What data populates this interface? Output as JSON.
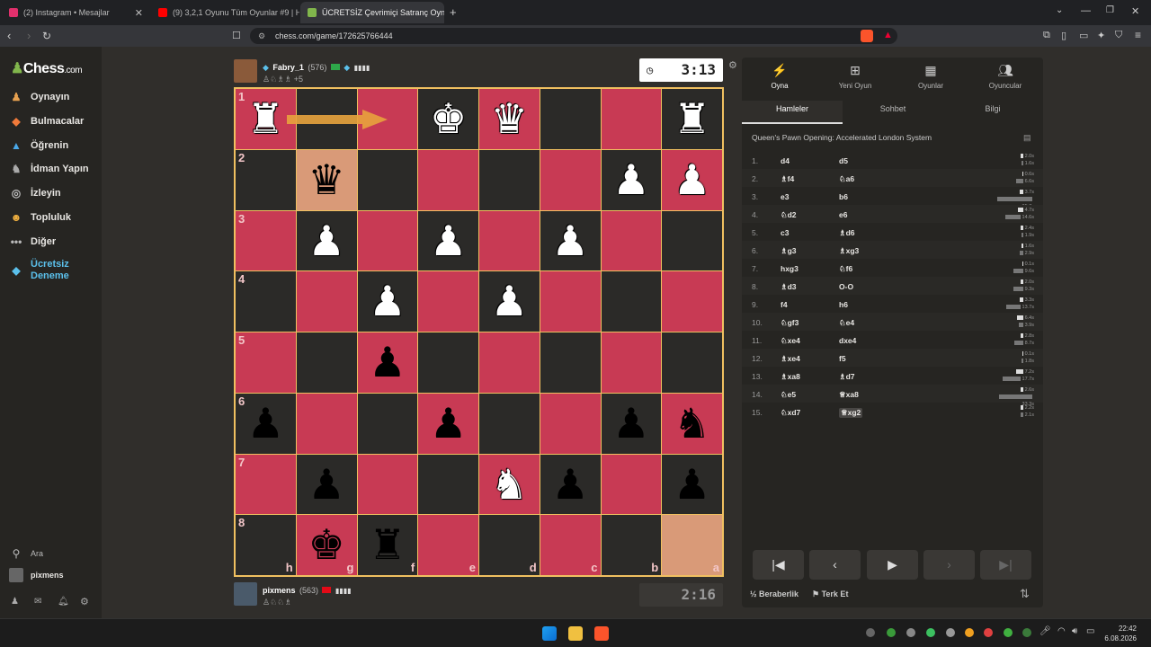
{
  "browser": {
    "tabs": [
      {
        "title": "(2) Instagram • Mesajlar",
        "color": "#e1306c"
      },
      {
        "title": "(9) 3,2,1 Oyunu Tüm Oyunlar #9 | Ht",
        "color": "#ff0000"
      },
      {
        "title": "ÜCRETSİZ Çevrimiçi Satranç Oyna",
        "color": "#81b64c"
      }
    ],
    "url": "chess.com/game/172625766444"
  },
  "sidebar": {
    "logo": "Chess",
    "logo_suffix": ".com",
    "items": [
      {
        "label": "Oynayın",
        "icon": "play-icon"
      },
      {
        "label": "Bulmacalar",
        "icon": "puzzle-icon"
      },
      {
        "label": "Öğrenin",
        "icon": "learn-icon"
      },
      {
        "label": "İdman Yapın",
        "icon": "train-icon"
      },
      {
        "label": "İzleyin",
        "icon": "watch-icon"
      },
      {
        "label": "Topluluk",
        "icon": "community-icon"
      },
      {
        "label": "Diğer",
        "icon": "more-icon"
      }
    ],
    "trial": "Ücretsiz Deneme",
    "search": "Ara",
    "user": "pixmens"
  },
  "players": {
    "top": {
      "name": "Fabry_1",
      "rating": "(576)",
      "captured": "♙♘♗♗ +5",
      "clock": "3:13"
    },
    "bottom": {
      "name": "pixmens",
      "rating": "(563)",
      "captured": "♙♘♘♗",
      "clock": "2:16"
    }
  },
  "board": {
    "ranks": [
      "1",
      "2",
      "3",
      "4",
      "5",
      "6",
      "7",
      "8"
    ],
    "files": [
      "h",
      "g",
      "f",
      "e",
      "d",
      "c",
      "b",
      "a"
    ],
    "rows": [
      [
        "wR",
        "",
        "",
        "wK",
        "wQ",
        "",
        "",
        "wR"
      ],
      [
        "",
        "bQ",
        "",
        "",
        "",
        "",
        "wP",
        "wP"
      ],
      [
        "",
        "wP",
        "",
        "wP",
        "",
        "wP",
        "",
        ""
      ],
      [
        "",
        "",
        "wP",
        "",
        "wP",
        "",
        "",
        ""
      ],
      [
        "",
        "",
        "bP",
        "",
        "",
        "",
        "",
        ""
      ],
      [
        "bP",
        "",
        "",
        "bP",
        "",
        "",
        "bP",
        "bN"
      ],
      [
        "",
        "bP",
        "",
        "",
        "wN",
        "bP",
        "",
        "bP"
      ],
      [
        "",
        "bK",
        "bR",
        "",
        "",
        "",
        "",
        ""
      ]
    ],
    "highlights": [
      [
        1,
        1
      ],
      [
        7,
        7
      ]
    ]
  },
  "panel": {
    "tabs": [
      {
        "label": "Oyna",
        "icon": "play-icon"
      },
      {
        "label": "Yeni Oyun",
        "icon": "plus-icon"
      },
      {
        "label": "Oyunlar",
        "icon": "board-icon"
      },
      {
        "label": "Oyuncular",
        "icon": "players-icon"
      }
    ],
    "subtabs": [
      "Hamleler",
      "Sohbet",
      "Bilgi"
    ],
    "opening": "Queen's Pawn Opening: Accelerated London System",
    "moves": [
      {
        "n": "1.",
        "w": "d4",
        "b": "d5",
        "tw": "2.0s",
        "tb": "1.6s"
      },
      {
        "n": "2.",
        "w": "♗f4",
        "b": "♘a6",
        "tw": "0.6s",
        "tb": "6.6s"
      },
      {
        "n": "3.",
        "w": "e3",
        "b": "b6",
        "tw": "3.7s",
        "tb": "35.7s"
      },
      {
        "n": "4.",
        "w": "♘d2",
        "b": "e6",
        "tw": "4.7s",
        "tb": "14.6s"
      },
      {
        "n": "5.",
        "w": "c3",
        "b": "♗d6",
        "tw": "2.4s",
        "tb": "1.9s"
      },
      {
        "n": "6.",
        "w": "♗g3",
        "b": "♗xg3",
        "tw": "1.6s",
        "tb": "2.9s"
      },
      {
        "n": "7.",
        "w": "hxg3",
        "b": "♘f6",
        "tw": "0.1s",
        "tb": "9.6s"
      },
      {
        "n": "8.",
        "w": "♗d3",
        "b": "O-O",
        "tw": "2.0s",
        "tb": "9.3s"
      },
      {
        "n": "9.",
        "w": "f4",
        "b": "h6",
        "tw": "3.3s",
        "tb": "13.7s"
      },
      {
        "n": "10.",
        "w": "♘gf3",
        "b": "♘e4",
        "tw": "6.4s",
        "tb": "3.9s"
      },
      {
        "n": "11.",
        "w": "♘xe4",
        "b": "dxe4",
        "tw": "2.8s",
        "tb": "8.7s"
      },
      {
        "n": "12.",
        "w": "♗xe4",
        "b": "f5",
        "tw": "0.1s",
        "tb": "1.8s"
      },
      {
        "n": "13.",
        "w": "♗xa8",
        "b": "♗d7",
        "tw": "7.2s",
        "tb": "17.7s"
      },
      {
        "n": "14.",
        "w": "♘e5",
        "b": "♕xa8",
        "tw": "2.6s",
        "tb": "33.3s"
      },
      {
        "n": "15.",
        "w": "♘xd7",
        "b": "♕xg2",
        "tw": "2.2s",
        "tb": "2.1s"
      }
    ],
    "draw": "Beraberlik",
    "resign": "Terk Et"
  },
  "taskbar": {
    "time": "22:42",
    "date": "6.08.2026"
  },
  "colors": {
    "dark": "#2b2a28",
    "light": "#c83a54",
    "highlight": "#d99a78",
    "arrow": "#e8a33d"
  }
}
